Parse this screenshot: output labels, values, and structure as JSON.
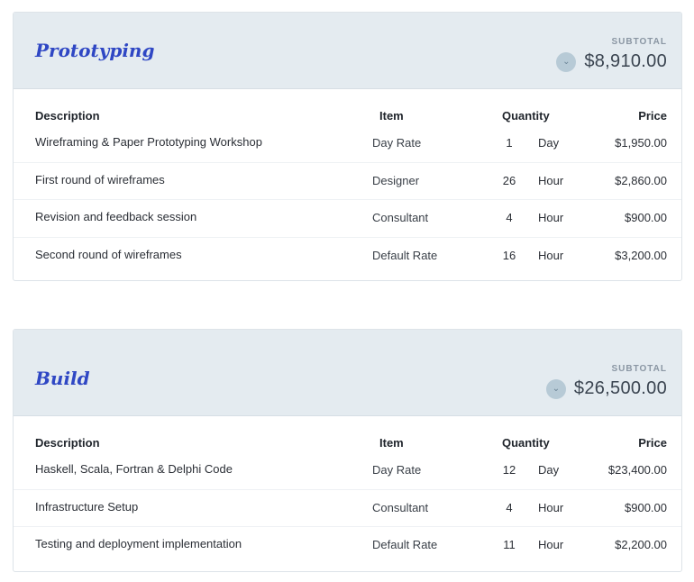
{
  "columns": {
    "description": "Description",
    "item": "Item",
    "quantity": "Quantity",
    "price": "Price"
  },
  "sections": [
    {
      "title": "Prototyping",
      "subtotal_label": "SUBTOTAL",
      "subtotal": "$8,910.00",
      "rows": [
        {
          "description": "Wireframing & Paper Prototyping Workshop",
          "item": "Day Rate",
          "quantity": "1",
          "unit": "Day",
          "price": "$1,950.00"
        },
        {
          "description": "First round of wireframes",
          "item": "Designer",
          "quantity": "26",
          "unit": "Hour",
          "price": "$2,860.00"
        },
        {
          "description": "Revision and feedback session",
          "item": "Consultant",
          "quantity": "4",
          "unit": "Hour",
          "price": "$900.00"
        },
        {
          "description": "Second round of wireframes",
          "item": "Default Rate",
          "quantity": "16",
          "unit": "Hour",
          "price": "$3,200.00"
        }
      ]
    },
    {
      "title": "Build",
      "subtotal_label": "SUBTOTAL",
      "subtotal": "$26,500.00",
      "rows": [
        {
          "description": "Haskell, Scala, Fortran & Delphi Code",
          "item": "Day Rate",
          "quantity": "12",
          "unit": "Day",
          "price": "$23,400.00"
        },
        {
          "description": "Infrastructure Setup",
          "item": "Consultant",
          "quantity": "4",
          "unit": "Hour",
          "price": "$900.00"
        },
        {
          "description": "Testing and deployment implementation",
          "item": "Default Rate",
          "quantity": "11",
          "unit": "Hour",
          "price": "$2,200.00"
        }
      ]
    }
  ],
  "icons": {
    "collapse_toggle": "chevron-down-icon"
  },
  "colors": {
    "title": "#2f47c4",
    "header_bg": "#e4ebf0",
    "toggle_bg": "#b7cad6"
  }
}
